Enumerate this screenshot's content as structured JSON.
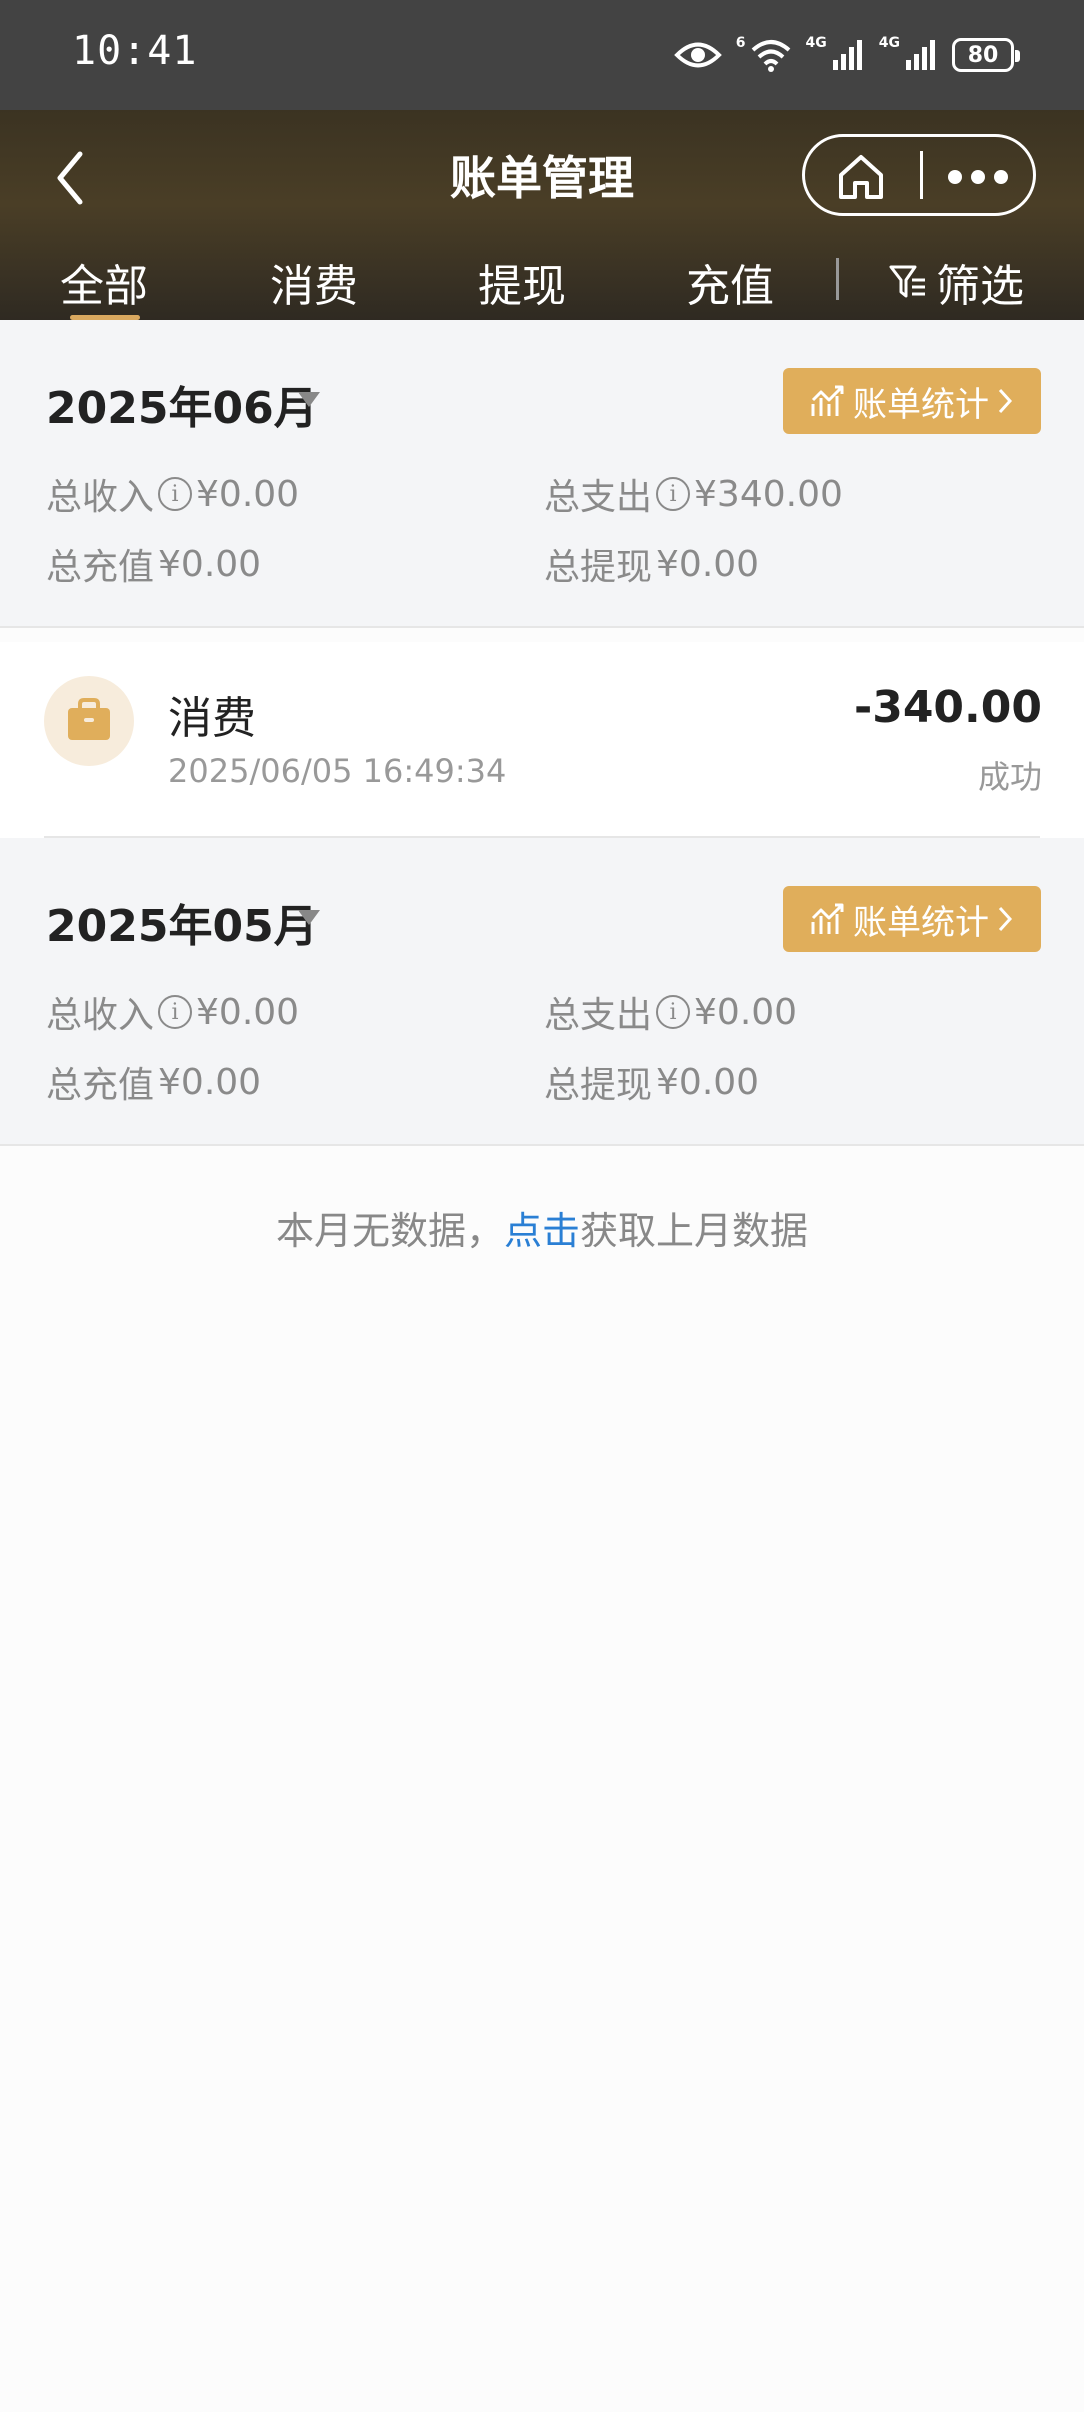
{
  "status_bar": {
    "time": "10:41",
    "battery": "80",
    "network_1": "4G",
    "network_2": "4G",
    "wifi_tag": "6"
  },
  "header": {
    "title": "账单管理",
    "tabs": [
      "全部",
      "消费",
      "提现",
      "充值"
    ],
    "active_tab": 0,
    "filter_label": "筛选"
  },
  "months": [
    {
      "title": "2025年06月",
      "stats_button": "账单统计",
      "income_label": "总收入",
      "income_value": "¥0.00",
      "expense_label": "总支出",
      "expense_value": "¥340.00",
      "recharge_label": "总充值",
      "recharge_value": "¥0.00",
      "withdraw_label": "总提现",
      "withdraw_value": "¥0.00"
    },
    {
      "title": "2025年05月",
      "stats_button": "账单统计",
      "income_label": "总收入",
      "income_value": "¥0.00",
      "expense_label": "总支出",
      "expense_value": "¥0.00",
      "recharge_label": "总充值",
      "recharge_value": "¥0.00",
      "withdraw_label": "总提现",
      "withdraw_value": "¥0.00"
    }
  ],
  "transaction": {
    "name": "消费",
    "time": "2025/06/05 16:49:34",
    "amount": "-340.00",
    "status": "成功",
    "icon": "bag-icon"
  },
  "empty": {
    "prefix": "本月无数据，",
    "link": "点击",
    "suffix": "获取上月数据"
  },
  "colors": {
    "accent": "#e0ae5b",
    "link": "#2a7fd4",
    "header_bg": "#3b3322"
  }
}
